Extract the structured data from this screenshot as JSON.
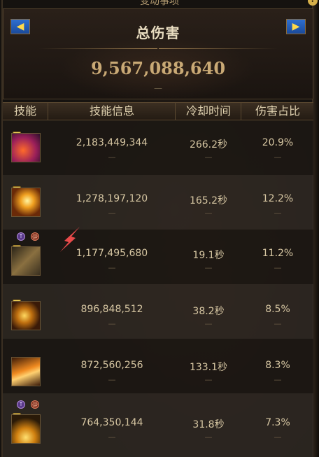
{
  "window": {
    "title": "变动事项",
    "help_icon": "?"
  },
  "header": {
    "prev_icon": "◀",
    "next_icon": "▶",
    "title": "总伤害",
    "total_damage": "9,567,088,640",
    "dash": "—"
  },
  "columns": [
    "技能",
    "技能信息",
    "冷却时间",
    "伤害占比"
  ],
  "rows": [
    {
      "badge": "H",
      "damage": "2,183,449,344",
      "cooldown": "266.2秒",
      "percent": "20.9%",
      "dash": "—"
    },
    {
      "badge": "H",
      "damage": "1,278,197,120",
      "cooldown": "165.2秒",
      "percent": "12.2%",
      "dash": "—"
    },
    {
      "badge": "H",
      "damage": "1,177,495,680",
      "cooldown": "19.1秒",
      "percent": "11.2%",
      "dash": "—"
    },
    {
      "badge": "H",
      "damage": "896,848,512",
      "cooldown": "38.2秒",
      "percent": "8.5%",
      "dash": "—"
    },
    {
      "badge": "",
      "damage": "872,560,256",
      "cooldown": "133.1秒",
      "percent": "8.3%",
      "dash": "—"
    },
    {
      "badge": "H",
      "damage": "764,350,144",
      "cooldown": "31.8秒",
      "percent": "7.3%",
      "dash": "—"
    }
  ],
  "colors": {
    "accent_gold": "#c9a975",
    "nav_blue": "#2e6fd0",
    "arrow_red": "#e84a4a"
  }
}
